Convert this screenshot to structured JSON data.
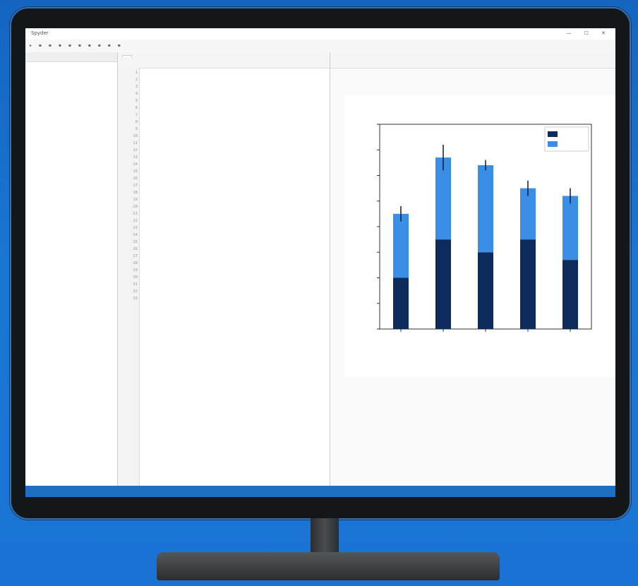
{
  "colors": {
    "background": "#1a73d4",
    "statusbar": "#1e6fc2",
    "bar_men": "#0d2b5c",
    "bar_women": "#3a8ee6"
  },
  "window": {
    "title": "Spyder",
    "controls": "— ☐ ✕"
  },
  "toolbar": {
    "icons": "▸ ▪ ▪ ▪ ▪ ▪ ▪ ▪ ▪ ▪",
    "right": ""
  },
  "left_panel": {
    "header": "",
    "items": [
      "",
      "",
      "",
      "",
      "",
      "",
      "",
      "",
      "",
      "",
      "",
      "",
      "",
      "",
      "",
      "",
      "",
      "",
      "",
      "",
      "",
      "",
      "",
      "",
      "",
      "",
      "",
      "",
      "",
      "",
      "",
      "",
      "",
      "",
      "",
      "",
      "",
      "",
      "",
      "",
      "",
      "",
      "",
      "",
      "",
      "",
      "",
      "",
      "",
      "",
      "",
      "",
      "",
      "",
      "",
      "",
      ""
    ]
  },
  "editor": {
    "tab": "",
    "line_numbers": [
      "1",
      "2",
      "3",
      "4",
      "5",
      "6",
      "7",
      "8",
      "9",
      "10",
      "11",
      "12",
      "13",
      "14",
      "15",
      "16",
      "17",
      "18",
      "19",
      "20",
      "21",
      "22",
      "23",
      "24",
      "25",
      "26",
      "27",
      "28",
      "29",
      "30",
      "31",
      "32",
      "33"
    ],
    "lines": [
      {
        "t": "",
        "cls": "c"
      },
      {
        "t": "",
        "cls": ""
      },
      {
        "t": "",
        "cls": ""
      },
      {
        "t": "",
        "cls": ""
      },
      {
        "t": "",
        "cls": ""
      },
      {
        "t": "",
        "cls": ""
      },
      {
        "t": "",
        "cls": ""
      },
      {
        "t": "",
        "cls": ""
      },
      {
        "t": "",
        "cls": ""
      },
      {
        "t": "",
        "cls": ""
      },
      {
        "t": "",
        "cls": ""
      },
      {
        "t": "",
        "cls": ""
      },
      {
        "t": "",
        "cls": ""
      },
      {
        "t": "",
        "cls": ""
      },
      {
        "t": "",
        "cls": ""
      },
      {
        "t": "",
        "cls": ""
      },
      {
        "t": "",
        "cls": ""
      },
      {
        "t": "",
        "cls": ""
      },
      {
        "t": "",
        "cls": ""
      },
      {
        "t": "",
        "cls": "k"
      },
      {
        "t": "",
        "cls": "k"
      },
      {
        "t": "",
        "cls": ""
      },
      {
        "t": "",
        "cls": ""
      },
      {
        "t": "",
        "cls": ""
      },
      {
        "t": "",
        "cls": ""
      },
      {
        "t": "",
        "cls": ""
      },
      {
        "t": "",
        "cls": ""
      },
      {
        "t": "",
        "cls": ""
      },
      {
        "t": "",
        "cls": ""
      },
      {
        "t": "",
        "cls": ""
      }
    ]
  },
  "plot_pane": {
    "header": ""
  },
  "status": {
    "left": "",
    "right": ""
  },
  "chart_data": {
    "type": "bar",
    "stacked": true,
    "title": "",
    "xlabel": "",
    "ylabel": "",
    "categories": [
      "",
      "",
      "",
      "",
      ""
    ],
    "ylim": [
      0,
      80
    ],
    "yticks": [
      "",
      "",
      "",
      "",
      "",
      "",
      "",
      "",
      ""
    ],
    "series": [
      {
        "name": "",
        "color": "#0d2b5c",
        "values": [
          20,
          35,
          30,
          35,
          27
        ]
      },
      {
        "name": "",
        "color": "#3a8ee6",
        "values": [
          25,
          32,
          34,
          20,
          25
        ],
        "errors": [
          3,
          5,
          2,
          3,
          3
        ]
      }
    ],
    "legend": "top-right",
    "grid": false
  }
}
